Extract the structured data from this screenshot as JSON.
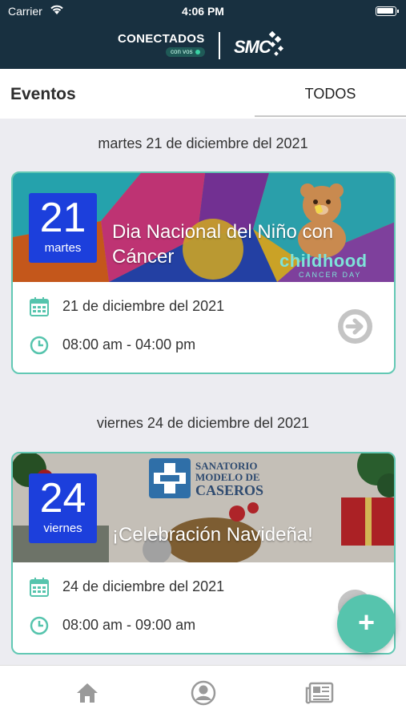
{
  "status": {
    "carrier": "Carrier",
    "time": "4:06 PM"
  },
  "header": {
    "brand": "CONECTADOS",
    "brand_sub": "con vos",
    "partner": "SMC"
  },
  "tabs": {
    "title": "Eventos",
    "filter": "TODOS"
  },
  "events": [
    {
      "date_heading": "martes 21 de diciembre del 2021",
      "day_number": "21",
      "weekday": "martes",
      "title": "Dia Nacional del Niño con Cáncer",
      "date": "21 de diciembre del 2021",
      "time": "08:00 am - 04:00 pm",
      "banner_text": "childhood",
      "banner_subtext": "CANCER DAY"
    },
    {
      "date_heading": "viernes 24 de diciembre del 2021",
      "day_number": "24",
      "weekday": "viernes",
      "title": "¡Celebración Navideña!",
      "date": "24 de diciembre del 2021",
      "time": "08:00 am - 09:00 am",
      "banner_logo_line1": "SANATORIO",
      "banner_logo_line2": "MODELO DE",
      "banner_logo_line3": "CASEROS"
    }
  ],
  "fab": {
    "label": "+"
  },
  "icons": {
    "home": "home-icon",
    "profile": "profile-icon",
    "news": "newspaper-icon"
  },
  "colors": {
    "header": "#183040",
    "accent": "#56c4ad",
    "datebox": "#1c3fdc"
  }
}
